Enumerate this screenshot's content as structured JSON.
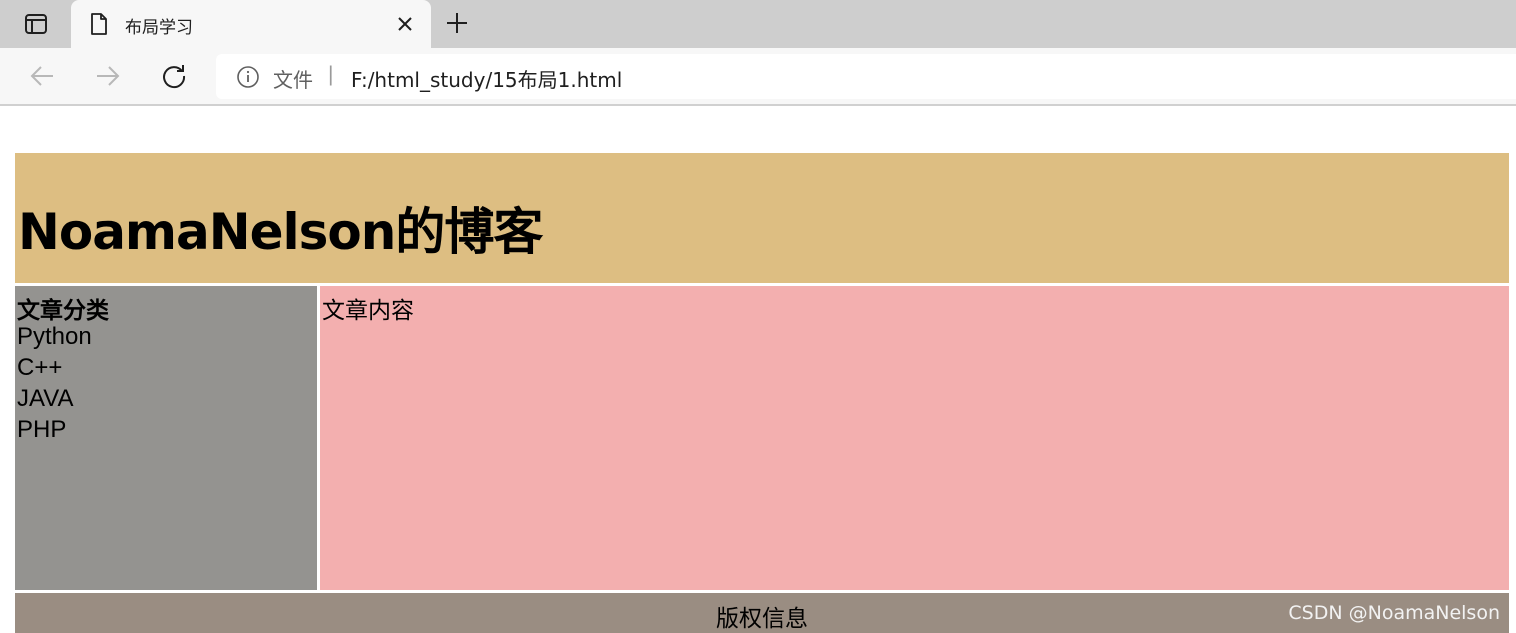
{
  "browser": {
    "tab": {
      "title": "布局学习"
    },
    "address": {
      "scheme_label": "文件",
      "separator": "|",
      "url": "F:/html_study/15布局1.html"
    },
    "icons": [
      "tab-actions-icon",
      "page-icon",
      "close-icon",
      "plus-icon",
      "back-arrow-icon",
      "forward-arrow-icon",
      "reload-icon",
      "info-icon"
    ]
  },
  "page": {
    "header": {
      "title": "NoamaNelson的博客"
    },
    "menu": {
      "title": "文章分类",
      "items": [
        "Python",
        "C++",
        "JAVA",
        "PHP"
      ]
    },
    "content": {
      "text": "文章内容"
    },
    "footer": {
      "text": "版权信息"
    },
    "watermark": "CSDN @NoamaNelson"
  },
  "colors": {
    "header_bg": "#ddbe82",
    "menu_bg": "#949390",
    "content_bg": "#f3afaf",
    "footer_bg": "#9a8d82"
  }
}
